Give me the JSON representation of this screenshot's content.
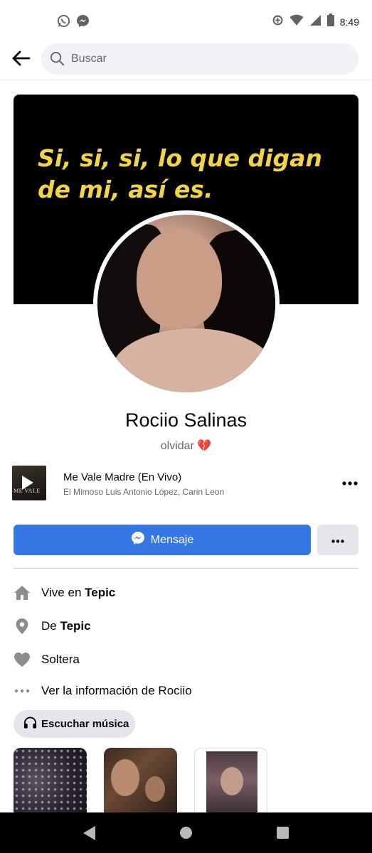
{
  "status_bar": {
    "time": "8:49",
    "left_icons": [
      "whatsapp-icon",
      "messenger-icon"
    ],
    "right_icons": [
      "data-saver-icon",
      "wifi-icon",
      "signal-icon",
      "battery-icon"
    ]
  },
  "search": {
    "placeholder": "Buscar",
    "value": ""
  },
  "cover": {
    "text": "Si, si, si, lo que digan de mi, así es.",
    "text_color": "#f2d544",
    "background": "#000000"
  },
  "profile": {
    "name": "Rociio Salinas",
    "bio": "olvidar",
    "bio_emoji": "💔"
  },
  "music": {
    "album_label": "ME VALE",
    "title": "Me Vale Madre (En Vivo)",
    "artist": "El Mimoso Luis Antonio López, Carin Leon"
  },
  "actions": {
    "message_label": "Mensaje",
    "accent_color": "#3578e5"
  },
  "info": {
    "lives_prefix": "Vive en ",
    "lives_city": "Tepic",
    "from_prefix": "De ",
    "from_city": "Tepic",
    "relationship": "Soltera",
    "see_info": "Ver la información de Rociio"
  },
  "music_chip": {
    "label": "Escuchar música"
  },
  "photos": {
    "count_visible": 3
  }
}
